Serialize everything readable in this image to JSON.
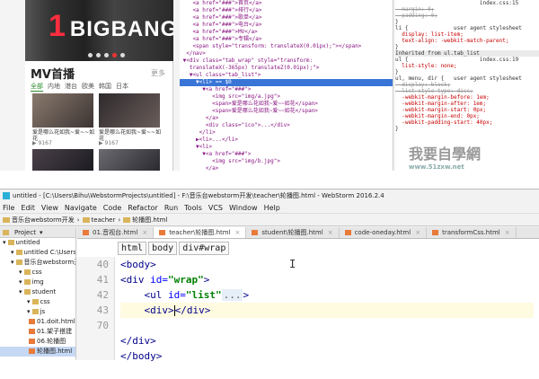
{
  "phone": {
    "banner_number": "1",
    "banner_text": "BIGBANG",
    "mv_title": "MV首播",
    "mv_more": "更多",
    "tabs": [
      "全部",
      "内地",
      "港台",
      "欧美",
      "韩国",
      "日本"
    ],
    "active_tab": "全部",
    "items": [
      {
        "caption": "爱是哪么花如我~爱~~如花",
        "count": "9167"
      },
      {
        "caption": "爱是哪么花如我~爱~~如花",
        "count": "9167"
      }
    ]
  },
  "devtools": {
    "elements": [
      {
        "text": "    <a href=\"###\">首页</a>",
        "sel": false
      },
      {
        "text": "    <a href=\"###\">排行</a>",
        "sel": false
      },
      {
        "text": "    <a href=\"###\">歌单</a>",
        "sel": false
      },
      {
        "text": "    <a href=\"###\">电台</a>",
        "sel": false
      },
      {
        "text": "    <a href=\"###\">MV</a>",
        "sel": false
      },
      {
        "text": "    <a href=\"###\">专辑</a>",
        "sel": false
      },
      {
        "text": "    <span style=\"transform: translateX(0.01px);\"></span>",
        "sel": false
      },
      {
        "text": "  </nav>",
        "sel": false
      },
      {
        "text": " ▼<div class=\"tab_wrap\" style=\"transform:",
        "sel": false
      },
      {
        "text": "   translateX(-365px) translateZ(0.01px);\">",
        "sel": false
      },
      {
        "text": "   ▼<ul class=\"tab_list\">",
        "sel": false
      },
      {
        "text": "     ▼<li> == $0",
        "sel": true
      },
      {
        "text": "       ▼<a href=\"###\">",
        "sel": false
      },
      {
        "text": "          <img src=\"img/a.jpg\">",
        "sel": false
      },
      {
        "text": "          <span>爱是哪么花如我~爱~~如花</span>",
        "sel": false
      },
      {
        "text": "          <span>爱是哪么花如我~爱~~如花</span>",
        "sel": false
      },
      {
        "text": "        </a>",
        "sel": false
      },
      {
        "text": "        <div class=\"ico\">...</div>",
        "sel": false
      },
      {
        "text": "      </li>",
        "sel": false
      },
      {
        "text": "     ▶<li>...</li>",
        "sel": false
      },
      {
        "text": "     ▼<li>",
        "sel": false
      },
      {
        "text": "       ▼<a href=\"###\">",
        "sel": false
      },
      {
        "text": "          <img src=\"img/b.jpg\">",
        "sel": false
      },
      {
        "text": "        </a>",
        "sel": false
      }
    ],
    "styles": [
      {
        "text": "                          index.css:15",
        "cls": ""
      },
      {
        "text": "  margin: 0;",
        "cls": "strike"
      },
      {
        "text": "  padding: 0;",
        "cls": "strike"
      },
      {
        "text": "}",
        "cls": ""
      },
      {
        "text": "li {              user agent stylesheet",
        "cls": ""
      },
      {
        "text": "  display: list-item;",
        "cls": "red"
      },
      {
        "text": "  text-align: -webkit-match-parent;",
        "cls": "red"
      },
      {
        "text": "}",
        "cls": ""
      },
      {
        "text": "Inherited from ul.tab_list",
        "cls": "inh"
      },
      {
        "text": "ul {                      index.css:19",
        "cls": ""
      },
      {
        "text": "  list-style: none;",
        "cls": "red"
      },
      {
        "text": "}",
        "cls": ""
      },
      {
        "text": "ul, menu, dir {   user agent stylesheet",
        "cls": ""
      },
      {
        "text": "  display: block;",
        "cls": "strike"
      },
      {
        "text": "  list-style-type: disc;",
        "cls": "strike"
      },
      {
        "text": "  -webkit-margin-before: 1em;",
        "cls": "red"
      },
      {
        "text": "  -webkit-margin-after: 1em;",
        "cls": "red"
      },
      {
        "text": "  -webkit-margin-start: 0px;",
        "cls": "red"
      },
      {
        "text": "  -webkit-margin-end: 0px;",
        "cls": "red"
      },
      {
        "text": "  -webkit-padding-start: 40px;",
        "cls": "red"
      },
      {
        "text": "}",
        "cls": ""
      }
    ],
    "watermark": "我要自學網",
    "watermark_sub": "www.51zxw.net"
  },
  "webstorm": {
    "title": "untitled - [C:\\Users\\Bihu\\WebstormProjects\\untitled] - F:\\音乐台webstorm开发\\teacher\\轮播图.html - WebStorm 2016.2.4",
    "menu": [
      "File",
      "Edit",
      "View",
      "Navigate",
      "Code",
      "Refactor",
      "Run",
      "Tools",
      "VCS",
      "Window",
      "Help"
    ],
    "breadcrumbs": [
      "音乐台webstorm开发",
      "teacher",
      "轮播图.html"
    ],
    "project_label": "Project",
    "tree": [
      {
        "label": "untitled",
        "type": "dir",
        "indent": 0,
        "sel": false
      },
      {
        "label": "untitled  C:\\Users\\Bihu",
        "type": "dir",
        "indent": 1,
        "sel": false
      },
      {
        "label": "音乐台webstorm开发",
        "type": "dir",
        "indent": 1,
        "sel": false
      },
      {
        "label": "css",
        "type": "dir",
        "indent": 2,
        "sel": false
      },
      {
        "label": "img",
        "type": "dir",
        "indent": 2,
        "sel": false
      },
      {
        "label": "student",
        "type": "dir",
        "indent": 2,
        "sel": false
      },
      {
        "label": "css",
        "type": "dir",
        "indent": 3,
        "sel": false
      },
      {
        "label": "js",
        "type": "dir",
        "indent": 3,
        "sel": false
      },
      {
        "label": "01.doit.html",
        "type": "file",
        "indent": 3,
        "sel": false
      },
      {
        "label": "01.架子搭建",
        "type": "file",
        "indent": 3,
        "sel": false
      },
      {
        "label": "06.轮播图",
        "type": "file",
        "indent": 3,
        "sel": false
      },
      {
        "label": "轮播图.html",
        "type": "file",
        "indent": 3,
        "sel": true
      }
    ],
    "tabs": [
      {
        "label": "01.音视台.html",
        "active": false
      },
      {
        "label": "teacher\\轮播图.html",
        "active": true
      },
      {
        "label": "student\\轮播图.html",
        "active": false
      },
      {
        "label": "code-oneday.html",
        "active": false
      },
      {
        "label": "transformCss.html",
        "active": false
      }
    ],
    "path": [
      "html",
      "body",
      "div#wrap"
    ],
    "line_numbers": [
      "40",
      "41",
      "42",
      "43",
      "70",
      "",
      "",
      ""
    ]
  }
}
